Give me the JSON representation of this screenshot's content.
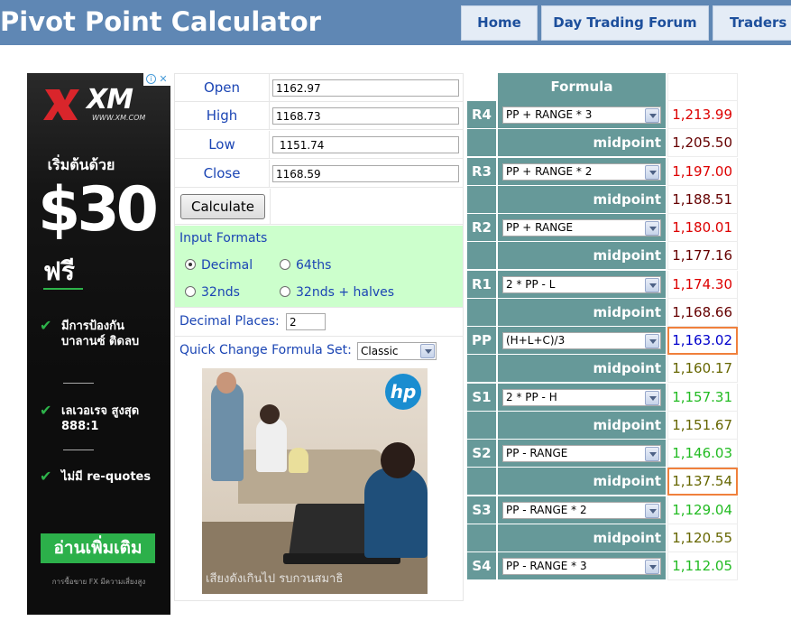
{
  "header": {
    "title": "Pivot Point Calculator",
    "nav": [
      {
        "label": "Home"
      },
      {
        "label": "Day Trading Forum"
      },
      {
        "label": "Traders D"
      }
    ]
  },
  "ad": {
    "brand": "XM",
    "url": "WWW.XM.COM",
    "start_text": "เริ่มต้นด้วย",
    "amount": "$30",
    "free": "ฟรี",
    "bullets": [
      "มีการป้องกัน บาลานซ์ ติดลบ",
      "เลเวอเรจ สูงสุด 888:1",
      "ไม่มี re-quotes"
    ],
    "cta": "อ่านเพิ่มเติม",
    "disclaimer": "การซื้อขาย FX มีความเสี่ยงสูง",
    "close_icon": "close-icon",
    "info_icon": "info-icon"
  },
  "inputs": {
    "open_label": "Open",
    "open_value": "1162.97",
    "high_label": "High",
    "high_value": "1168.73",
    "low_label": "Low",
    "low_value": " 1151.74",
    "close_label": "Close",
    "close_value": "1168.59",
    "calculate_label": "Calculate"
  },
  "formats": {
    "title": "Input Formats",
    "options": [
      {
        "label": "Decimal",
        "selected": true
      },
      {
        "label": "64ths",
        "selected": false
      },
      {
        "label": "32nds",
        "selected": false
      },
      {
        "label": "32nds + halves",
        "selected": false
      }
    ]
  },
  "decimal_places": {
    "label": "Decimal Places:",
    "value": "2"
  },
  "quick_change": {
    "label": "Quick Change Formula Set:",
    "value": "Classic"
  },
  "photo": {
    "brand": "hp",
    "caption": "เสียงดังเกินไป รบกวนสมาธิ"
  },
  "pivot": {
    "header": "Formula",
    "midpoint_label": "midpoint",
    "rows": [
      {
        "code": "R4",
        "formula": "PP + RANGE * 3",
        "value": "1,213.99",
        "mid": "1,205.50"
      },
      {
        "code": "R3",
        "formula": "PP + RANGE * 2",
        "value": "1,197.00",
        "mid": "1,188.51"
      },
      {
        "code": "R2",
        "formula": "PP + RANGE",
        "value": "1,180.01",
        "mid": "1,177.16"
      },
      {
        "code": "R1",
        "formula": "2 * PP - L",
        "value": "1,174.30",
        "mid": "1,168.66"
      },
      {
        "code": "PP",
        "formula": "(H+L+C)/3",
        "value": "1,163.02",
        "mid": "1,160.17"
      },
      {
        "code": "S1",
        "formula": "2 * PP - H",
        "value": "1,157.31",
        "mid": "1,151.67"
      },
      {
        "code": "S2",
        "formula": "PP - RANGE",
        "value": "1,146.03",
        "mid": "1,137.54"
      },
      {
        "code": "S3",
        "formula": "PP - RANGE * 2",
        "value": "1,129.04",
        "mid": "1,120.55"
      },
      {
        "code": "S4",
        "formula": "PP - RANGE * 3",
        "value": "1,112.05",
        "mid": null
      }
    ],
    "colors": {
      "resistance": "#dd0000",
      "resistance_mid": "#660000",
      "pivot": "#0000cc",
      "support_mid": "#666600",
      "support": "#22bb22",
      "highlight_border": "#f0803c",
      "cell_bg": "#669999"
    }
  }
}
